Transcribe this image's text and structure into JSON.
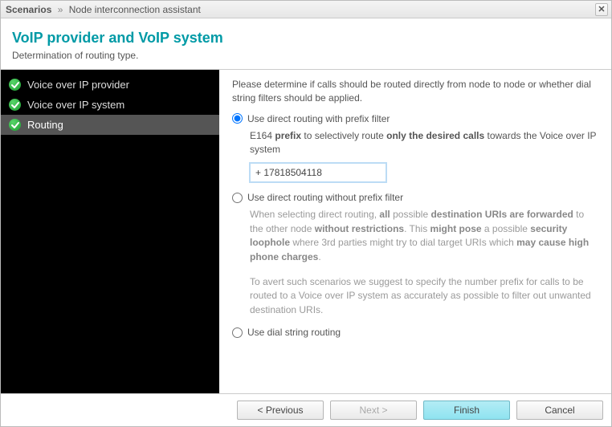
{
  "titlebar": {
    "crumb1": "Scenarios",
    "sep": "»",
    "crumb2": "Node interconnection assistant",
    "close": "✕"
  },
  "header": {
    "title": "VoIP provider and VoIP system",
    "subtitle": "Determination of routing type."
  },
  "sidebar": {
    "items": [
      {
        "label": "Voice over IP provider"
      },
      {
        "label": "Voice over IP system"
      },
      {
        "label": "Routing"
      }
    ]
  },
  "content": {
    "intro": "Please determine if calls should be routed directly from node to node or whether dial string filters should be applied.",
    "opt1": {
      "label": "Use direct routing with prefix filter",
      "desc_pre": "E164 ",
      "desc_b1": "prefix",
      "desc_mid": " to selectively route ",
      "desc_b2": "only the desired calls",
      "desc_post": " towards the Voice over IP system",
      "value": "+ 17818504118"
    },
    "opt2": {
      "label": "Use direct routing without prefix filter",
      "p1_a": "When selecting direct routing, ",
      "p1_b1": "all",
      "p1_b": " possible ",
      "p1_b2": "destination URIs are forwarded",
      "p1_c": " to the other node ",
      "p1_b3": "without restrictions",
      "p1_d": ". This ",
      "p1_b4": "might pose",
      "p1_e": " a possible ",
      "p1_b5": "security loophole",
      "p1_f": " where 3rd parties might try to dial target URIs which ",
      "p1_b6": "may cause high phone charges",
      "p1_g": ".",
      "p2": "To avert such scenarios we suggest to specify the number prefix for calls to be routed to a Voice over IP system as accurately as possible to filter out unwanted destination URIs."
    },
    "opt3": {
      "label": "Use dial string routing"
    }
  },
  "footer": {
    "previous": "< Previous",
    "next": "Next >",
    "finish": "Finish",
    "cancel": "Cancel"
  }
}
